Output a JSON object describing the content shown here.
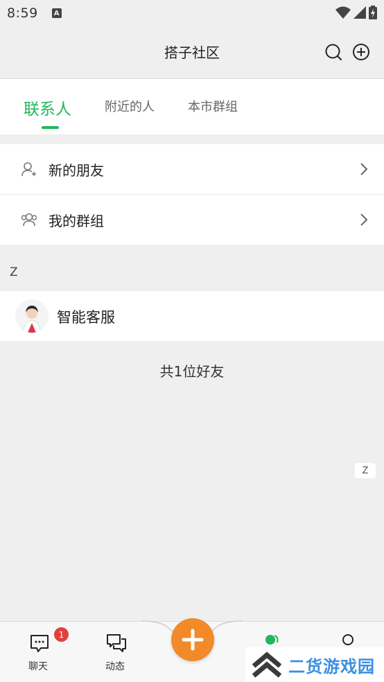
{
  "status_bar": {
    "time": "8:59",
    "a_badge": "A"
  },
  "title_bar": {
    "title": "搭子社区"
  },
  "tabs": [
    {
      "label": "联系人",
      "active": true
    },
    {
      "label": "附近的人",
      "active": false
    },
    {
      "label": "本市群组",
      "active": false
    }
  ],
  "entries": {
    "new_friends": "新的朋友",
    "my_groups": "我的群组"
  },
  "section_letter": "Z",
  "contact": {
    "name": "智能客服"
  },
  "friend_count": "共1位好友",
  "index_letter": "Z",
  "bottom_nav": {
    "chat_label": "聊天",
    "chat_badge": "1",
    "moments_label": "动态"
  },
  "watermark": {
    "text": "二货游戏园"
  },
  "colors": {
    "accent": "#1fb85b",
    "fab": "#f28a2a",
    "badge": "#e0413d"
  }
}
